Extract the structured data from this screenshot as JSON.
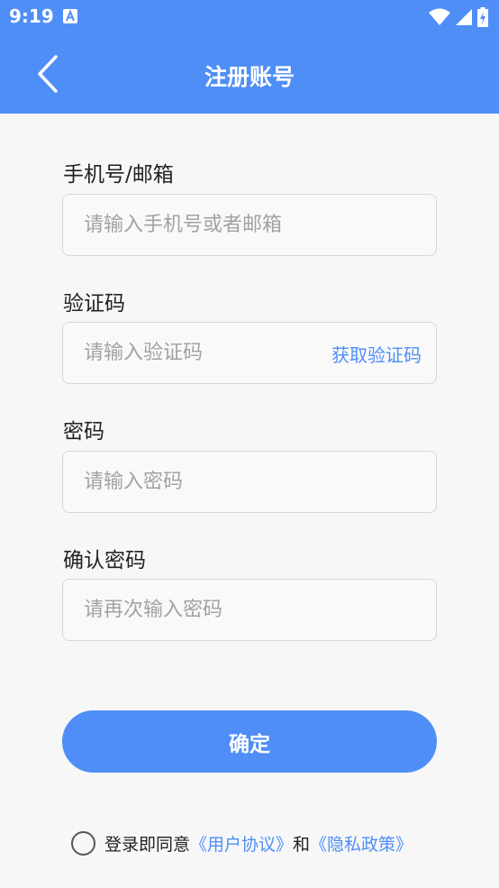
{
  "status_bar": {
    "time": "9:19",
    "app_icon": "a-icon",
    "wifi_icon": "wifi-icon",
    "signal_icon": "signal-icon",
    "battery_icon": "battery-charging-icon"
  },
  "header": {
    "back_icon": "chevron-left-icon",
    "title": "注册账号",
    "background_color": "#4f8ef7"
  },
  "form": {
    "account": {
      "label": "手机号/邮箱",
      "placeholder": "请输入手机号或者邮箱",
      "value": ""
    },
    "code": {
      "label": "验证码",
      "placeholder": "请输入验证码",
      "value": "",
      "action": "获取验证码"
    },
    "password": {
      "label": "密码",
      "placeholder": "请输入密码",
      "value": ""
    },
    "confirm_password": {
      "label": "确认密码",
      "placeholder": "请再次输入密码",
      "value": ""
    }
  },
  "confirm_button": "确定",
  "agreement": {
    "checked": false,
    "prefix": "登录即同意",
    "user_agreement": "《用户协议》",
    "conjunction": "和",
    "privacy_policy": "《隐私政策》"
  },
  "colors": {
    "accent": "#4f8ef7",
    "background": "#f7f7f7"
  }
}
